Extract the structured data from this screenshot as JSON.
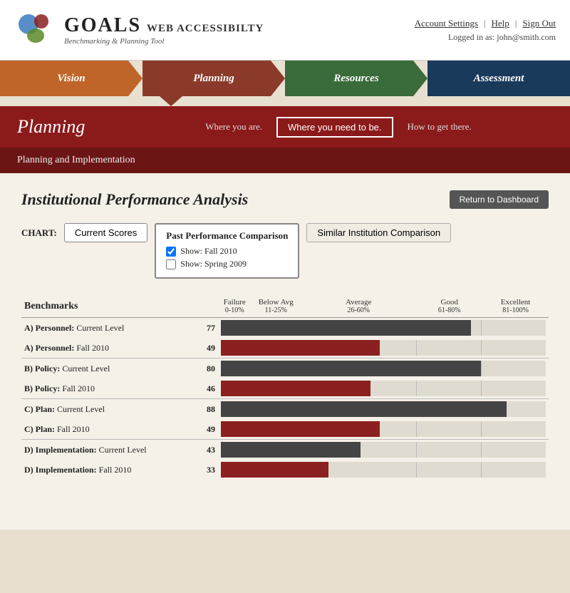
{
  "header": {
    "logo_goals": "GOALS",
    "logo_sub1": "WEB ACCESSIBILTY",
    "logo_sub2": "Benchmarking & Planning Tool",
    "links": {
      "account_settings": "Account Settings",
      "help": "Help",
      "sign_out": "Sign Out",
      "logged_in_label": "Logged in as:",
      "logged_in_user": "john@smith.com"
    }
  },
  "nav": {
    "items": [
      {
        "id": "vision",
        "label": "Vision"
      },
      {
        "id": "planning",
        "label": "Planning"
      },
      {
        "id": "resources",
        "label": "Resources"
      },
      {
        "id": "assessment",
        "label": "Assessment"
      }
    ]
  },
  "planning": {
    "title": "Planning",
    "where_you_are": "Where you are.",
    "where_you_need": "Where you need to be.",
    "how_to_get": "How to get there.",
    "sub_title": "Planning and Implementation"
  },
  "main": {
    "section_title": "Institutional Performance Analysis",
    "return_btn": "Return to Dashboard",
    "chart_label": "CHART:",
    "chart_buttons": {
      "current_scores": "Current Scores",
      "past_performance": "Past Performance Comparison",
      "show_fall_2010": "Show: Fall 2010",
      "show_spring_2009": "Show: Spring 2009",
      "similar_institution": "Similar Institution Comparison"
    },
    "benchmarks_header": "Benchmarks",
    "columns": [
      {
        "label": "Failure",
        "sub": "0-10%"
      },
      {
        "label": "Below Avg",
        "sub": "11-25%"
      },
      {
        "label": "Average",
        "sub": "26-60%"
      },
      {
        "label": "Good",
        "sub": "61-80%"
      },
      {
        "label": "Excellent",
        "sub": "81-100%"
      }
    ],
    "rows": [
      {
        "label_bold": "A) Personnel:",
        "label_rest": " Current Level",
        "score": 77,
        "type": "dark",
        "separator": false
      },
      {
        "label_bold": "A) Personnel:",
        "label_rest": " Fall 2010",
        "score": 49,
        "type": "red",
        "separator": false
      },
      {
        "label_bold": "B) Policy:",
        "label_rest": " Current Level",
        "score": 80,
        "type": "dark",
        "separator": true
      },
      {
        "label_bold": "B) Policy:",
        "label_rest": " Fall 2010",
        "score": 46,
        "type": "red",
        "separator": false
      },
      {
        "label_bold": "C) Plan:",
        "label_rest": " Current Level",
        "score": 88,
        "type": "dark",
        "separator": true
      },
      {
        "label_bold": "C) Plan:",
        "label_rest": " Fall 2010",
        "score": 49,
        "type": "red",
        "separator": false
      },
      {
        "label_bold": "D) Implementation:",
        "label_rest": " Current Level",
        "score": 43,
        "type": "dark",
        "separator": true
      },
      {
        "label_bold": "D) Implementation:",
        "label_rest": " Fall 2010",
        "score": 33,
        "type": "red",
        "separator": false
      }
    ]
  }
}
